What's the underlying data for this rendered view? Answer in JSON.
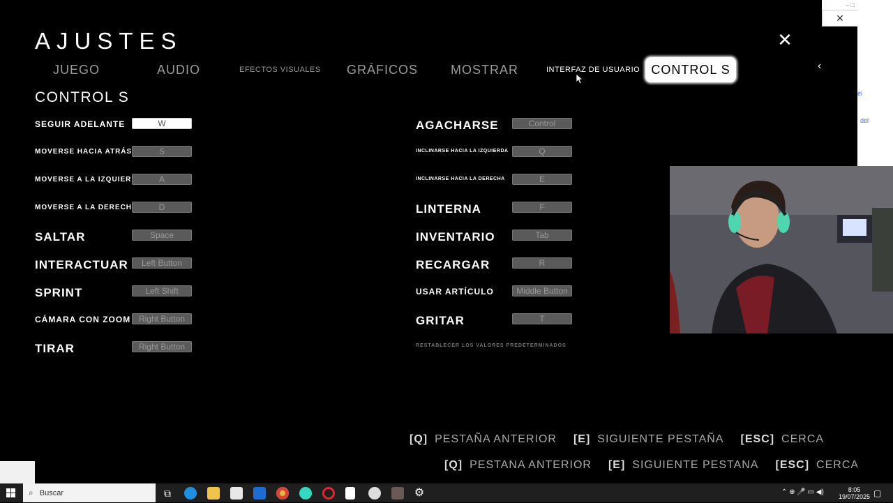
{
  "header": {
    "title": "AJUSTES",
    "close_icon": "close-icon"
  },
  "tabs": [
    {
      "label": "JUEGO"
    },
    {
      "label": "AUDIO"
    },
    {
      "label": "EFECTOS VISUALES"
    },
    {
      "label": "GRÁFICOS"
    },
    {
      "label": "MOSTRAR"
    },
    {
      "label": "INTERFAZ DE USUARIO"
    },
    {
      "label": "CONTROL S",
      "active": true
    }
  ],
  "section_title": "CONTROL S",
  "left_bindings": [
    {
      "action": "SEGUIR ADELANTE",
      "key": "W"
    },
    {
      "action": "MOVERSE HACIA ATRÁS",
      "key": "S"
    },
    {
      "action": "MOVERSE A LA IZQUIERDA",
      "key": "A"
    },
    {
      "action": "MOVERSE A LA DERECHA",
      "key": "D"
    },
    {
      "action": "SALTAR",
      "key": "Space"
    },
    {
      "action": "INTERACTUAR",
      "key": "Left Button"
    },
    {
      "action": "SPRINT",
      "key": "Left Shift"
    },
    {
      "action": "CÁMARA CON ZOOM",
      "key": "Right Button"
    },
    {
      "action": "TIRAR",
      "key": "Right Button"
    }
  ],
  "right_bindings": [
    {
      "action": "AGACHARSE",
      "key": "Control"
    },
    {
      "action": "INCLINARSE HACIA LA IZQUIERDA",
      "key": "Q"
    },
    {
      "action": "INCLINARSE HACIA LA DERECHA",
      "key": "E"
    },
    {
      "action": "LINTERNA",
      "key": "F"
    },
    {
      "action": "INVENTARIO",
      "key": "Tab"
    },
    {
      "action": "RECARGAR",
      "key": "R"
    },
    {
      "action": "USAR ARTÍCULO",
      "key": "Middle Button"
    },
    {
      "action": "GRITAR",
      "key": "T"
    }
  ],
  "reset_label": "RESTABLECER LOS VALORES PREDETERMINADOS",
  "footer_1": {
    "q_key": "[Q]",
    "prev": "PESTAÑA ANTERIOR",
    "e_key": "[E]",
    "next": "SIGUIENTE PESTAÑA",
    "esc_key": "[ESC]",
    "close": "CERCA"
  },
  "footer_2": {
    "q_key": "[Q]",
    "prev": "PESTANA ANTERIOR",
    "e_key": "[E]",
    "next": "SIGUIENTE PESTANA",
    "esc_key": "[ESC]",
    "close": "CERCA"
  },
  "side_window": {
    "link1": "el",
    "link2": "del"
  },
  "taskbar": {
    "search_placeholder": "Buscar",
    "time": "8:05",
    "date": "19/07/2025"
  },
  "colors": {
    "background": "#000000",
    "active_tab": "#ffffff",
    "key_box": "#5a5a5a"
  }
}
